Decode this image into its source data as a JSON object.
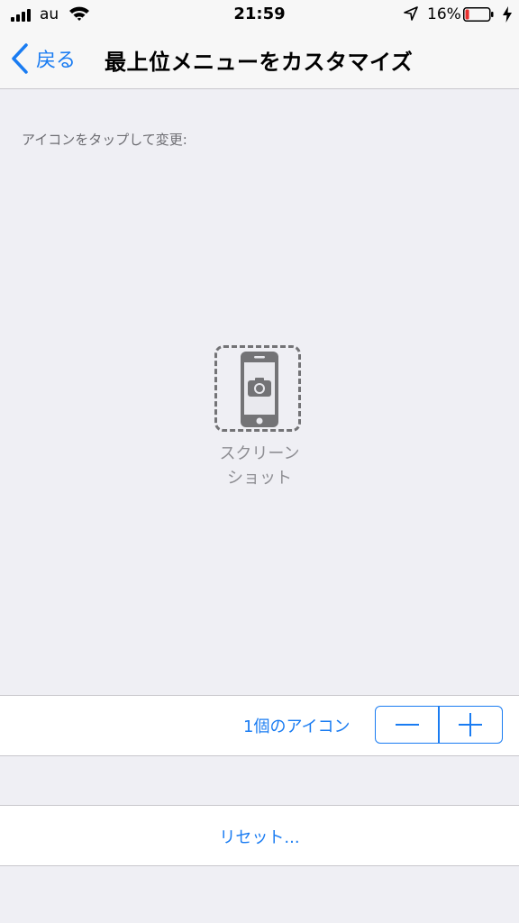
{
  "status_bar": {
    "carrier": "au",
    "time": "21:59",
    "battery_percent": "16%",
    "battery_level": 0.16,
    "signal_bars": 4
  },
  "nav": {
    "back_label": "戻る",
    "title": "最上位メニューをカスタマイズ"
  },
  "content": {
    "instruction": "アイコンをタップして変更:",
    "icon_label_line1": "スクリーン",
    "icon_label_line2": "ショット"
  },
  "stepper_row": {
    "count_label": "1個のアイコン"
  },
  "reset": {
    "label": "リセット..."
  },
  "colors": {
    "accent": "#1a7cf2",
    "background": "#efeff4",
    "battery_low": "#e8312f"
  }
}
